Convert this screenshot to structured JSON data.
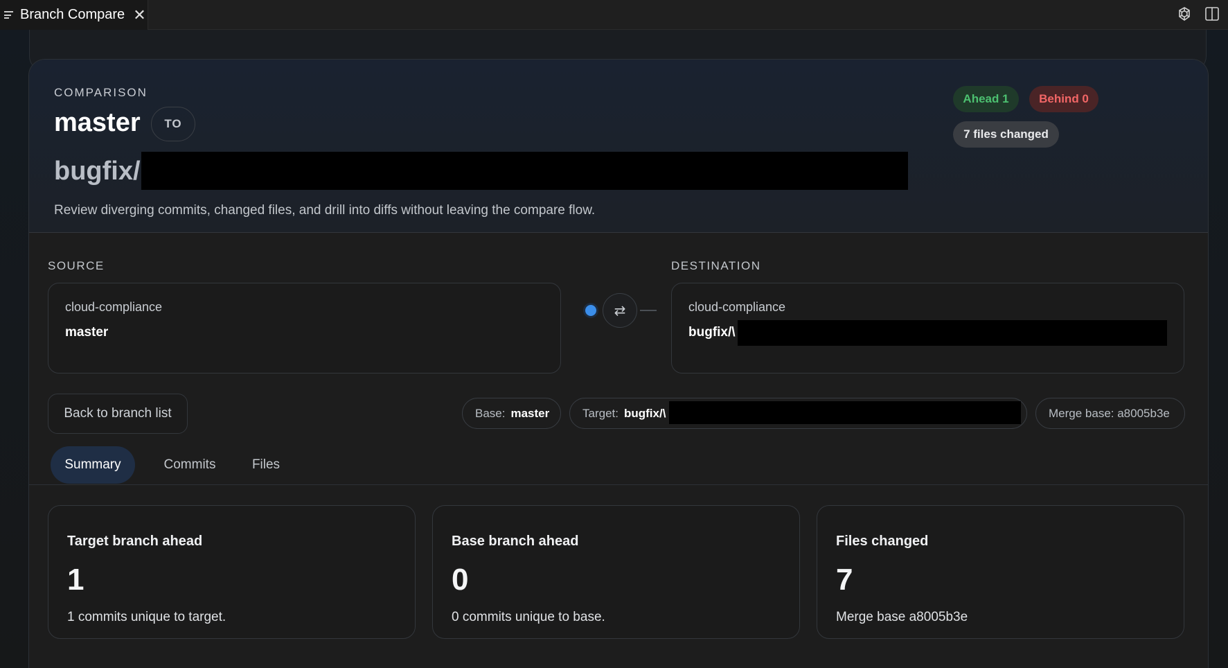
{
  "tab": {
    "title": "Branch Compare",
    "close_glyph": "✕"
  },
  "titlebar": {
    "icons": [
      "openai-icon",
      "split-editor-icon"
    ]
  },
  "hero": {
    "eyebrow": "COMPARISON",
    "base_branch": "master",
    "to_label": "TO",
    "target_branch_prefix": "bugfix/",
    "description": "Review diverging commits, changed files, and drill into diffs without leaving the compare flow.",
    "badges": {
      "ahead": "Ahead 1",
      "behind": "Behind 0",
      "files_changed": "7 files changed"
    }
  },
  "source": {
    "label": "SOURCE",
    "repo": "cloud-compliance",
    "branch": "master"
  },
  "destination": {
    "label": "DESTINATION",
    "repo": "cloud-compliance",
    "branch_prefix": "bugfix/\\"
  },
  "connector": {
    "swap_glyph": "⇄"
  },
  "actions": {
    "back_label": "Back to branch list"
  },
  "pills": {
    "base_label": "Base:",
    "base_value": "master",
    "target_label": "Target:",
    "target_value": "bugfix/\\",
    "merge_base": "Merge base: a8005b3e"
  },
  "tabs": [
    {
      "label": "Summary",
      "active": true
    },
    {
      "label": "Commits",
      "active": false
    },
    {
      "label": "Files",
      "active": false
    }
  ],
  "stats": [
    {
      "title": "Target branch ahead",
      "value": "1",
      "subtitle": "1 commits unique to target."
    },
    {
      "title": "Base branch ahead",
      "value": "0",
      "subtitle": "0 commits unique to base."
    },
    {
      "title": "Files changed",
      "value": "7",
      "subtitle": "Merge base a8005b3e"
    }
  ],
  "colors": {
    "accent": "#3b8eea",
    "ahead": "#4cc070",
    "behind": "#f26666"
  }
}
